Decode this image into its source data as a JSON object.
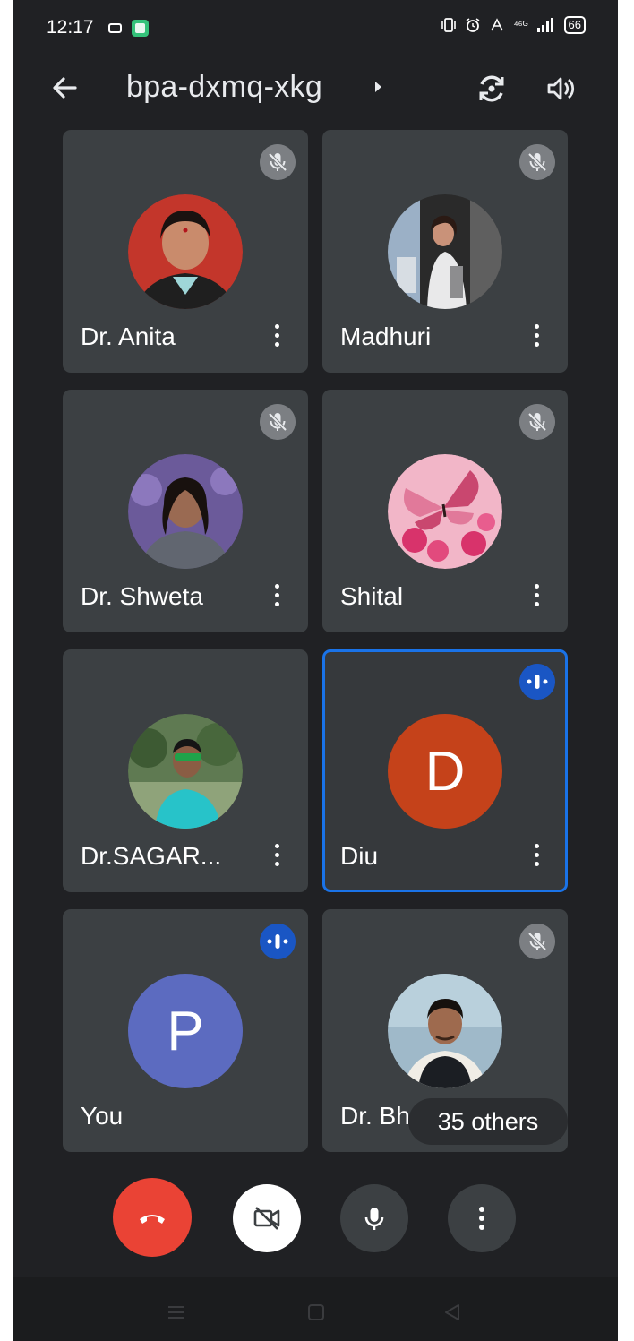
{
  "status": {
    "time": "12:17",
    "right_text": "⁴⁶ᴳ",
    "battery": "66"
  },
  "meeting": {
    "code": "bpa-dxmq-xkg"
  },
  "participants": [
    {
      "name": "Dr. Anita",
      "state": "muted",
      "avatar": "photo-woman-red-bg"
    },
    {
      "name": "Madhuri",
      "state": "muted",
      "avatar": "photo-woman-outdoor"
    },
    {
      "name": "Dr. Shweta",
      "state": "muted",
      "avatar": "photo-woman-purple-bg"
    },
    {
      "name": "Shital",
      "state": "muted",
      "avatar": "photo-butterfly"
    },
    {
      "name": "Dr.SAGAR...",
      "state": "unmuted",
      "avatar": "photo-man-trees"
    },
    {
      "name": "Diu",
      "state": "speaking",
      "avatar_letter": "D",
      "avatar_color": "#c5421a"
    },
    {
      "name": "You",
      "state": "speaking",
      "avatar_letter": "P",
      "avatar_color": "#5c6bc0"
    },
    {
      "name": "Dr. Bh",
      "state": "muted",
      "avatar": "photo-man-sky"
    }
  ],
  "overflow": {
    "others_label": "35 others"
  },
  "controls": [
    {
      "name": "end-call",
      "icon": "phone-hangup-icon",
      "color": "#ea4335"
    },
    {
      "name": "camera-toggle",
      "icon": "camera-off-icon",
      "color": "#ffffff"
    },
    {
      "name": "microphone-toggle",
      "icon": "microphone-icon",
      "color": "#3c4043"
    },
    {
      "name": "more-options",
      "icon": "more-vertical-icon",
      "color": "#3c4043"
    }
  ],
  "colors": {
    "background": "#202124",
    "tile": "#3c4043",
    "active_border": "#1a73e8",
    "speaking_badge": "#1a56c4"
  }
}
